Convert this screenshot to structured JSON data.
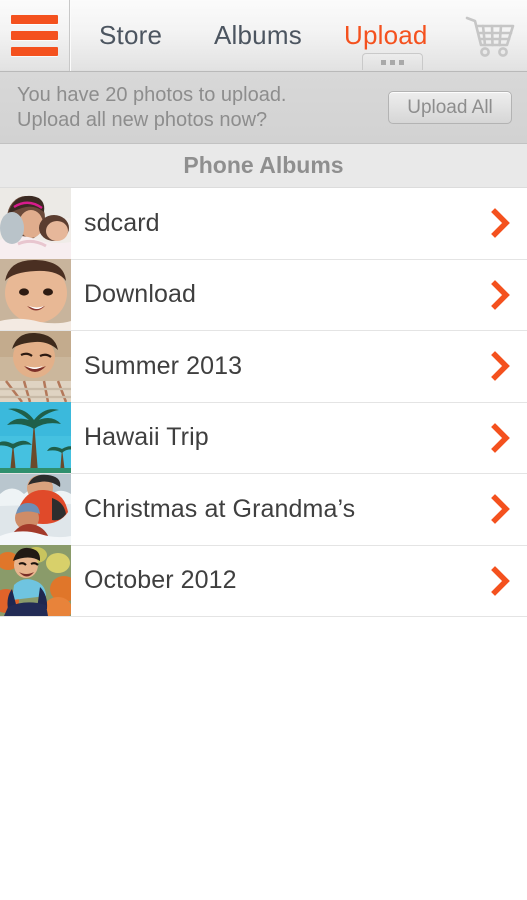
{
  "colors": {
    "accent": "#f4511e",
    "nav_text": "#4c5560",
    "notif_text": "#8d8d8d",
    "section_header_text": "#8f8f8f",
    "row_text": "#3f3f3f",
    "chevron": "#f4511e"
  },
  "navbar": {
    "menu_icon": "hamburger-icon",
    "cart_icon": "shopping-cart-icon",
    "items": [
      {
        "label": "Store",
        "active": false
      },
      {
        "label": "Albums",
        "active": false
      },
      {
        "label": "Upload",
        "active": true
      }
    ]
  },
  "notification": {
    "line1": "You have 20 photos to upload.",
    "line2": "Upload all new photos now?",
    "button_label": "Upload All"
  },
  "section": {
    "title": "Phone Albums"
  },
  "albums": [
    {
      "name": "sdcard",
      "thumb": "girl-kissing-baby-photo"
    },
    {
      "name": "Download",
      "thumb": "smiling-baby-photo"
    },
    {
      "name": "Summer 2013",
      "thumb": "boy-on-beach-photo"
    },
    {
      "name": "Hawaii Trip",
      "thumb": "palm-trees-photo"
    },
    {
      "name": "Christmas at Grandma’s",
      "thumb": "father-and-son-in-snow-photo"
    },
    {
      "name": "October 2012",
      "thumb": "boy-with-pumpkins-photo"
    }
  ]
}
